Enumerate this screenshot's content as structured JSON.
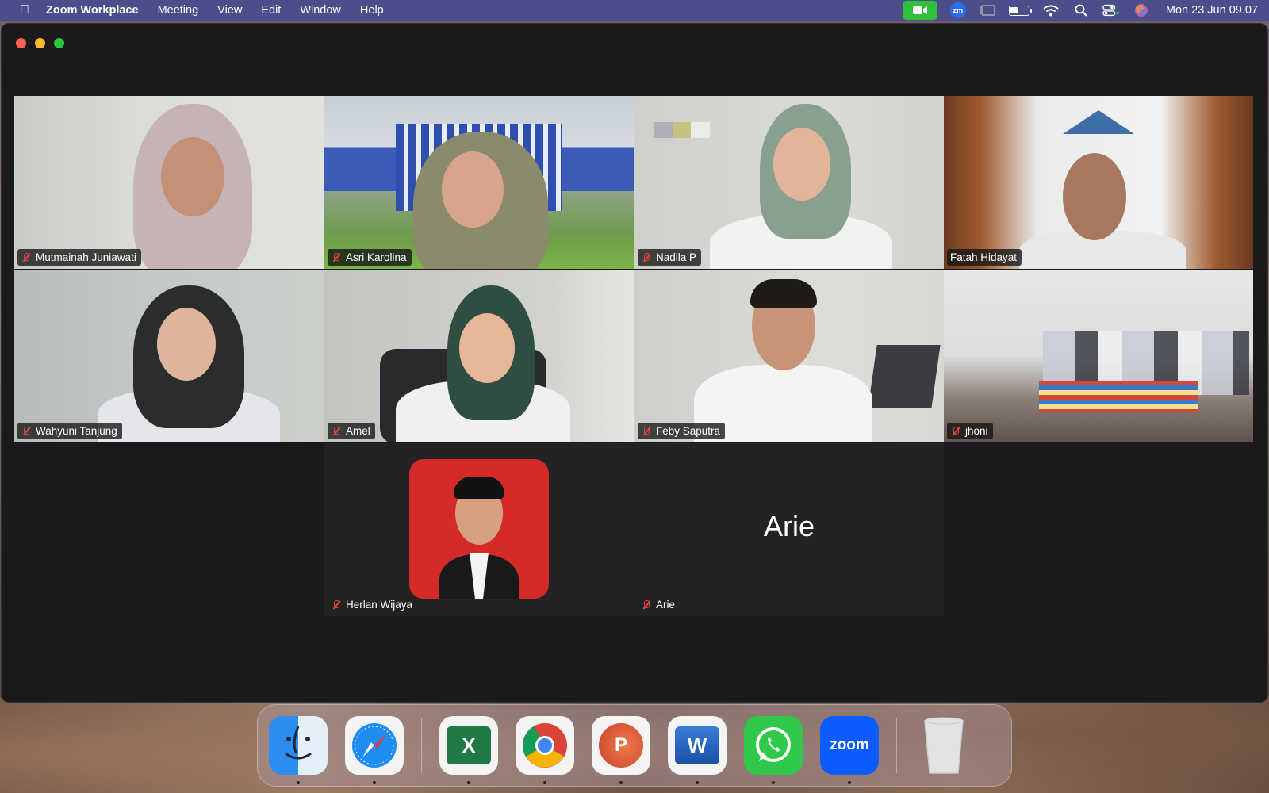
{
  "menubar": {
    "app_name": "Zoom Workplace",
    "menus": [
      "Meeting",
      "View",
      "Edit",
      "Window",
      "Help"
    ],
    "zoom_badge": "zm",
    "clock": "Mon 23 Jun  09.07"
  },
  "participants": [
    {
      "name": "Mutmainah Juniawati",
      "muted": true
    },
    {
      "name": "Asri Karolina",
      "muted": true
    },
    {
      "name": "Nadila P",
      "muted": true
    },
    {
      "name": "Fatah Hidayat",
      "muted": false,
      "active_speaker": true
    },
    {
      "name": "Wahyuni Tanjung",
      "muted": true
    },
    {
      "name": "Amel",
      "muted": true
    },
    {
      "name": "Feby Saputra",
      "muted": true
    },
    {
      "name": "jhoni",
      "muted": true
    },
    {
      "name": "Herlan Wijaya",
      "muted": true
    },
    {
      "name": "Arie",
      "muted": true,
      "camera_off": true
    }
  ],
  "camera_off_display": "Arie",
  "dock": {
    "apps": [
      "finder-icon",
      "safari-icon",
      "excel-icon",
      "chrome-icon",
      "powerpoint-icon",
      "word-icon",
      "whatsapp-icon",
      "zoom-icon",
      "trash-icon"
    ],
    "excel_glyph": "X",
    "powerpoint_glyph": "P",
    "word_glyph": "W",
    "zoom_glyph": "zoom"
  },
  "colors": {
    "menubar": "#4a4f8c",
    "active_speaker": "#2fd04a",
    "camera_on": "#2fbf3a",
    "mic_muted": "#e0463c"
  }
}
